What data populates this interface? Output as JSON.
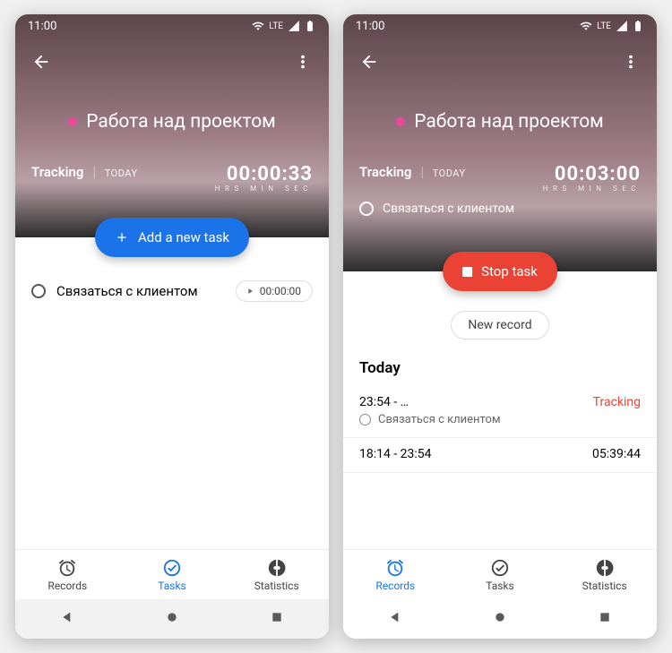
{
  "status": {
    "time": "11:00",
    "lte": "LTE"
  },
  "left": {
    "title": "Работа над проектом",
    "tracking_label": "Tracking",
    "tracking_period": "TODAY",
    "timer": "00:00:33",
    "timer_units": "HRS   MIN   SEC",
    "fab_label": "Add a new task",
    "task_name": "Связаться с клиентом",
    "task_time": "00:00:00",
    "nav": {
      "records": "Records",
      "tasks": "Tasks",
      "stats": "Statistics",
      "active": "tasks"
    }
  },
  "right": {
    "title": "Работа над проектом",
    "tracking_label": "Tracking",
    "tracking_period": "TODAY",
    "timer": "00:03:00",
    "timer_units": "HRS   MIN   SEC",
    "active_task": "Связаться с клиентом",
    "fab_label": "Stop task",
    "new_record": "New record",
    "section": "Today",
    "records": [
      {
        "time": "23:54 - …",
        "duration": "Tracking",
        "sub": "Связаться с клиентом",
        "tracking": true
      },
      {
        "time": "18:14 - 23:54",
        "duration": "05:39:44",
        "tracking": false
      }
    ],
    "nav": {
      "records": "Records",
      "tasks": "Tasks",
      "stats": "Statistics",
      "active": "records"
    }
  }
}
